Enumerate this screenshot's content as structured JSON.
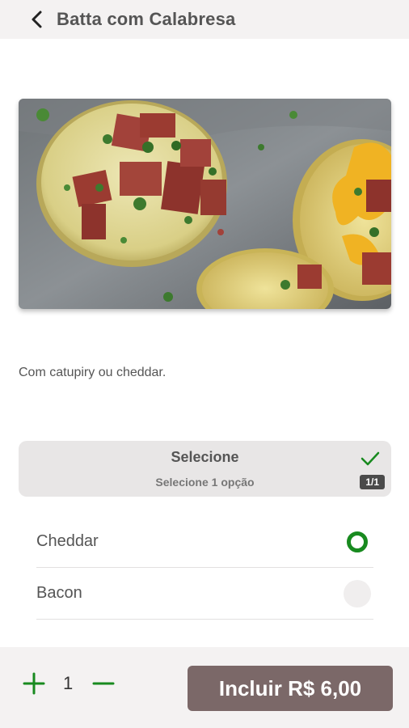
{
  "header": {
    "title": "Batta com Calabresa",
    "back_icon": "chevron-left-icon"
  },
  "product": {
    "image_alt": "Batatas recheadas com calabresa",
    "description": "Com catupiry ou cheddar."
  },
  "option_group": {
    "title": "Selecione",
    "subtitle": "Selecione 1 opção",
    "count": "1/1",
    "check_icon": "check-icon",
    "options": [
      {
        "label": "Cheddar",
        "selected": true
      },
      {
        "label": "Bacon",
        "selected": false
      }
    ]
  },
  "footer": {
    "quantity": "1",
    "add_label": "Incluir R$ 6,00"
  },
  "colors": {
    "accent_green": "#188a1f",
    "button_brown": "#7b6868",
    "header_bg": "#f4f2f2"
  }
}
